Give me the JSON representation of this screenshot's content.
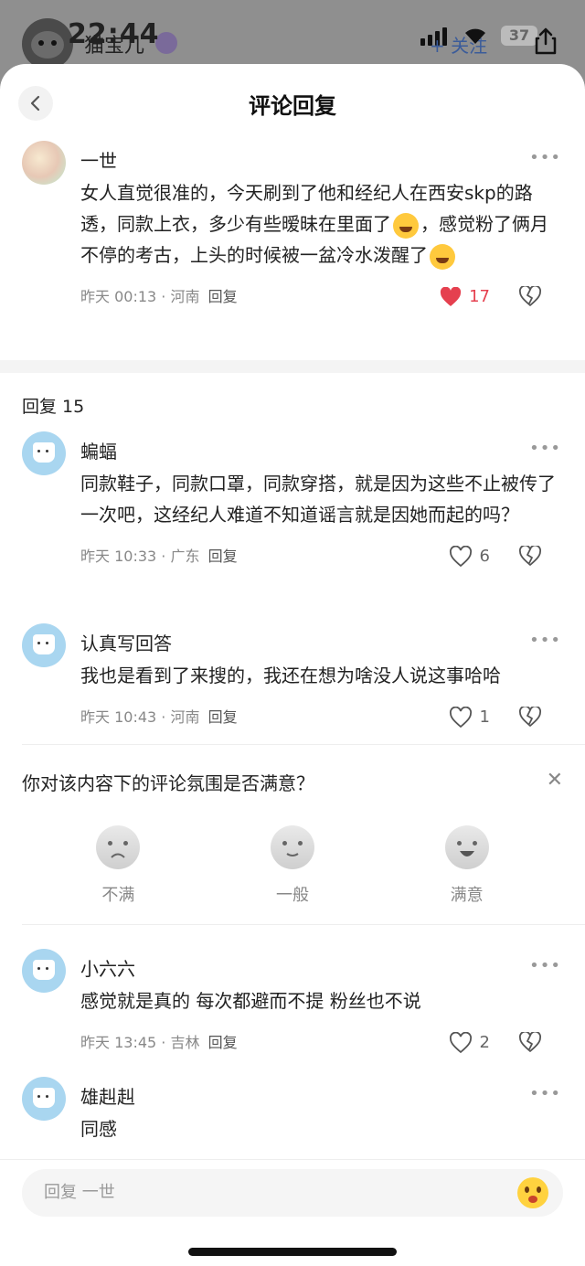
{
  "status_bar": {
    "time": "22:44",
    "user_name": "猫宝儿",
    "follow_label": "+ 关注",
    "battery": "37"
  },
  "header": {
    "title": "评论回复"
  },
  "main_comment": {
    "name": "一世",
    "text_part1": "女人直觉很准的，今天刷到了他和经纪人在西安skp的路透，同款上衣，多少有些暧昧在里面了",
    "text_part2": "，感觉粉了俩月不停的考古，上头的时候被一盆冷水泼醒了",
    "time": "昨天 00:13",
    "location": "河南",
    "reply_label": "回复",
    "likes": "17",
    "liked": true
  },
  "replies_header": {
    "label": "回复 15"
  },
  "replies": [
    {
      "name": "蝙蝠",
      "text": "同款鞋子，同款口罩，同款穿搭，就是因为这些不止被传了一次吧，这经纪人难道不知道谣言就是因她而起的吗？",
      "time": "昨天 10:33",
      "location": "广东",
      "reply_label": "回复",
      "likes": "6"
    },
    {
      "name": "认真写回答",
      "text": "我也是看到了来搜的，我还在想为啥没人说这事哈哈",
      "time": "昨天 10:43",
      "location": "河南",
      "reply_label": "回复",
      "likes": "1"
    }
  ],
  "survey": {
    "title": "你对该内容下的评论氛围是否满意？",
    "options": [
      "不满",
      "一般",
      "满意"
    ]
  },
  "replies2": [
    {
      "name": "小六六",
      "text": "感觉就是真的 每次都避而不提  粉丝也不说",
      "time": "昨天 13:45",
      "location": "吉林",
      "reply_label": "回复",
      "likes": "2"
    },
    {
      "name": "雄赳赳",
      "text": "同感"
    }
  ],
  "input": {
    "placeholder": "回复 一世"
  },
  "colors": {
    "like_active": "#e5404f",
    "sheet_bg": "#ffffff",
    "dim_bg": "#8f8f8f"
  }
}
